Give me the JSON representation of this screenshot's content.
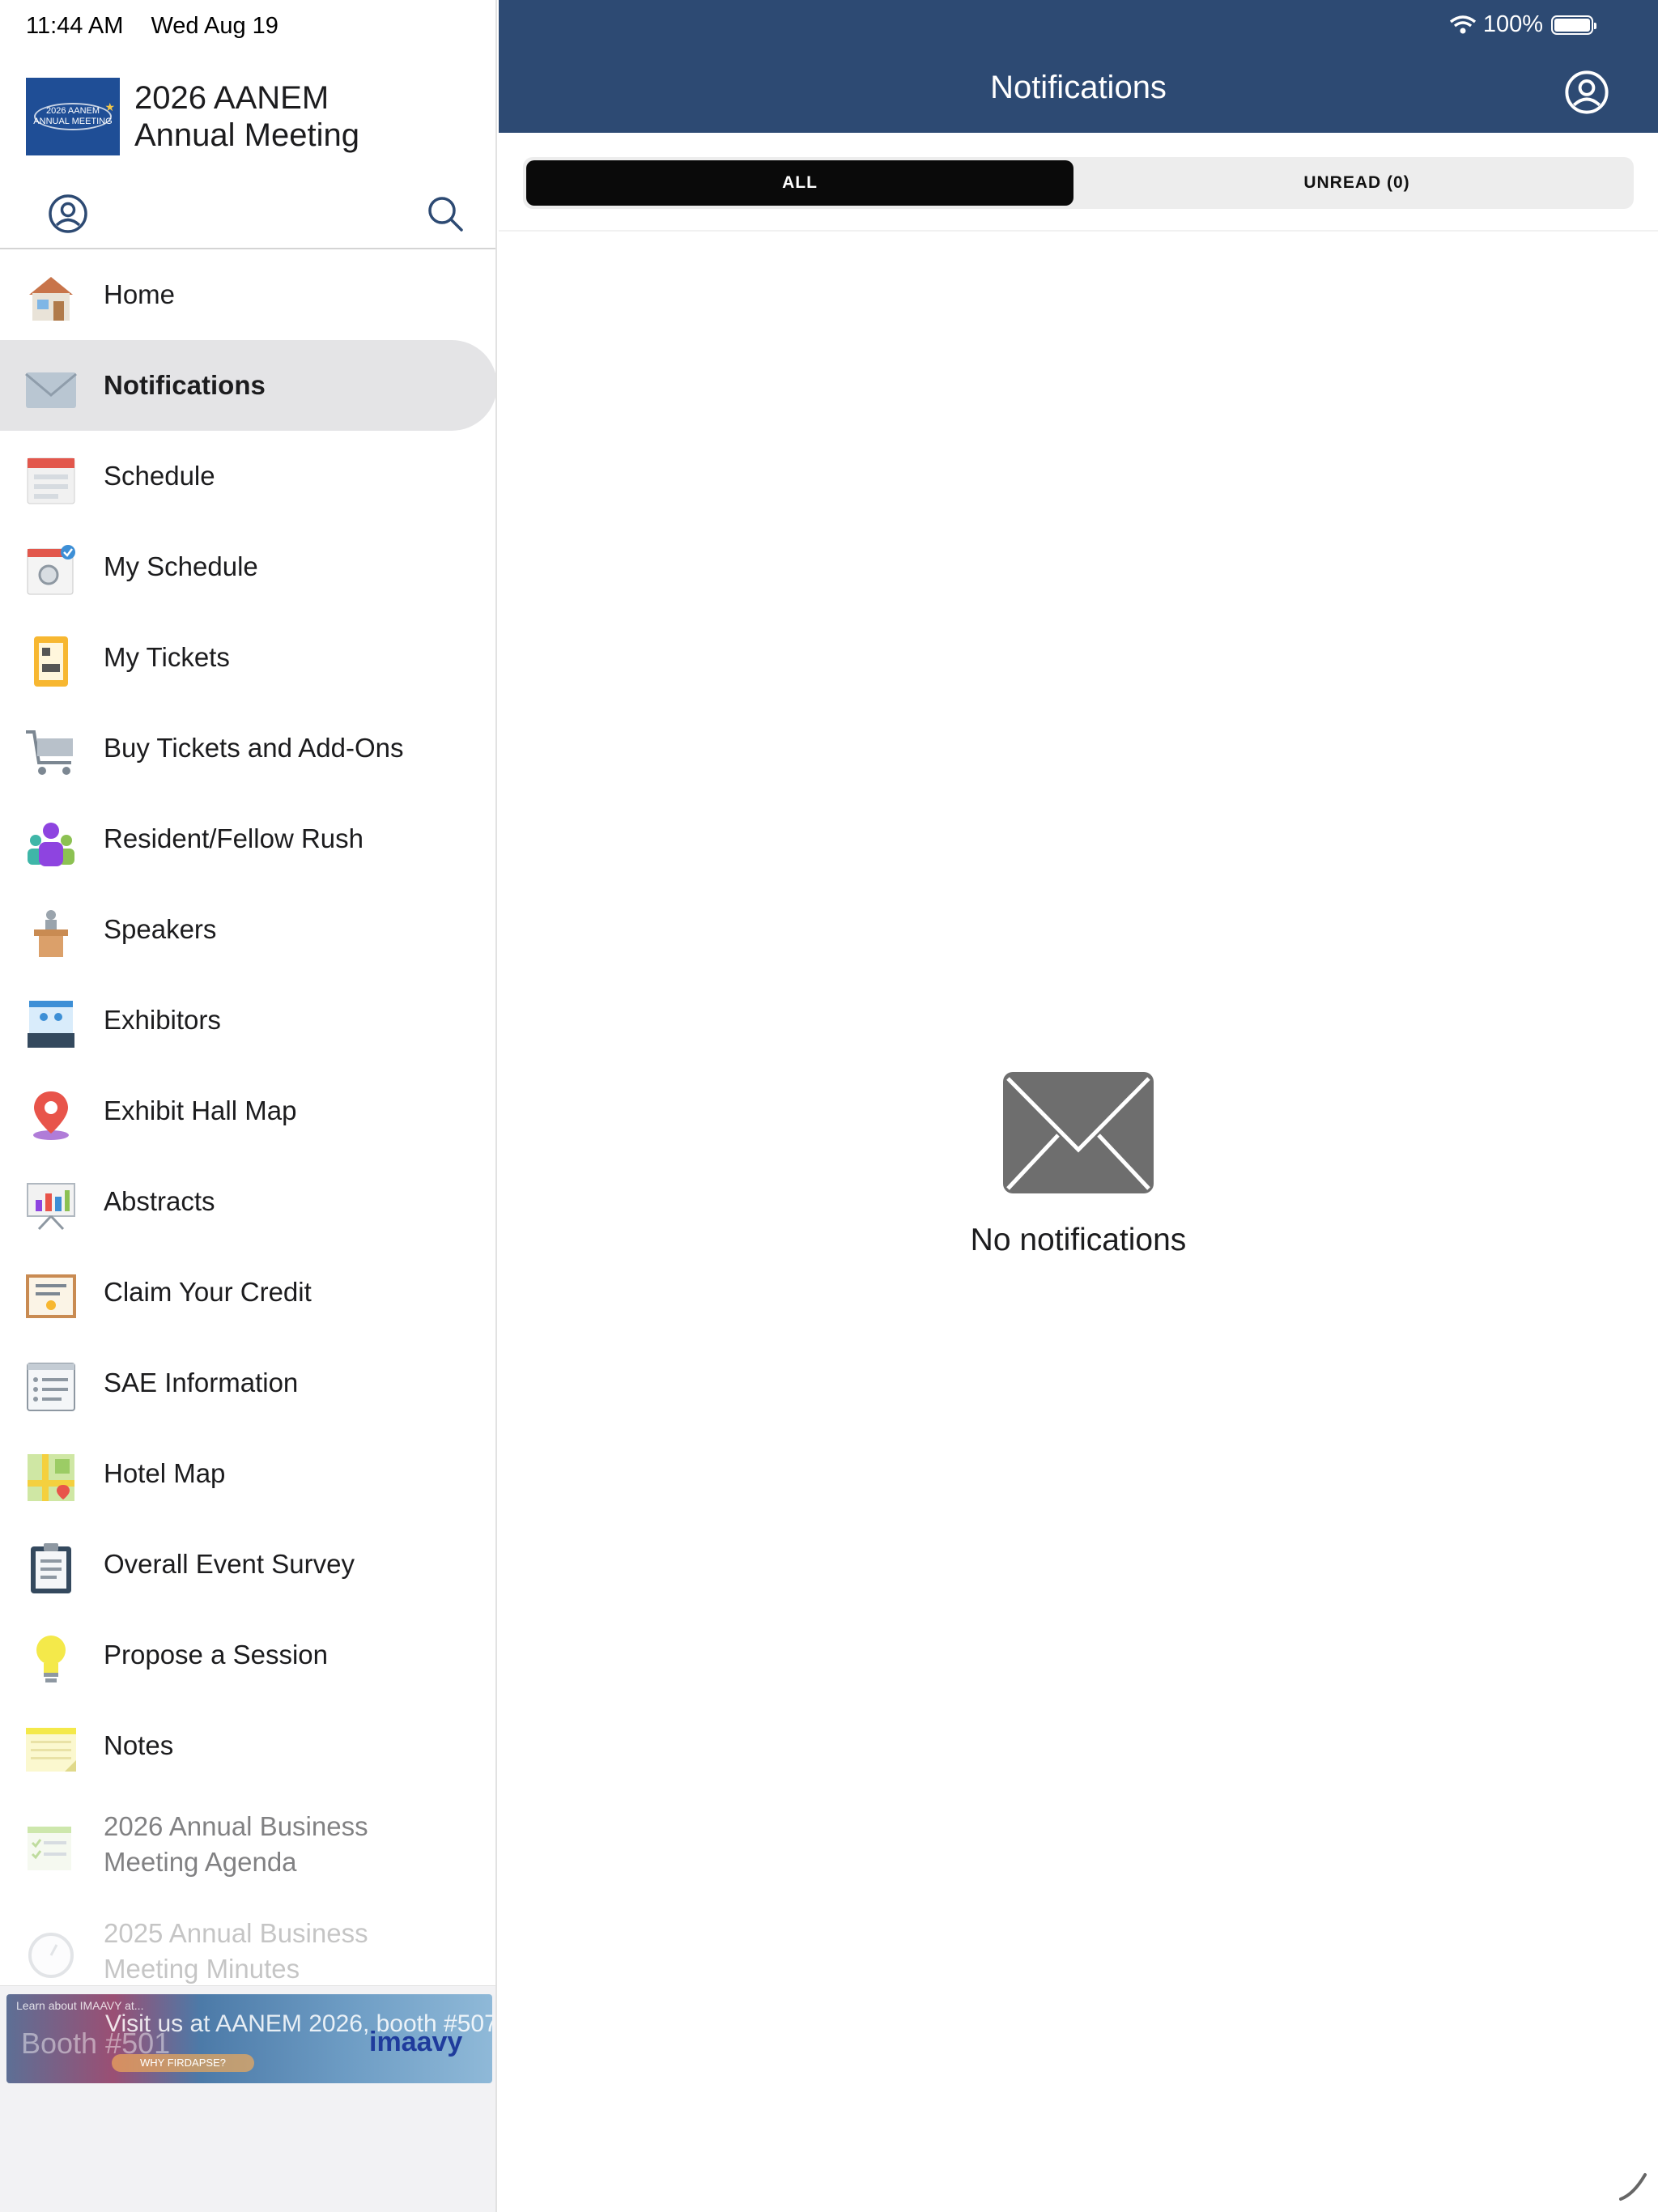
{
  "status_bar": {
    "time": "11:44 AM",
    "date": "Wed Aug 19",
    "battery": "100%"
  },
  "app": {
    "title": "2026 AANEM Annual Meeting",
    "logo_line1": "2026 AANEM",
    "logo_line2": "ANNUAL MEETING"
  },
  "sidebar": {
    "items": [
      {
        "label": "Home",
        "icon": "house-icon"
      },
      {
        "label": "Notifications",
        "icon": "envelope-icon",
        "active": true
      },
      {
        "label": "Schedule",
        "icon": "calendar-icon"
      },
      {
        "label": "My Schedule",
        "icon": "calendar-check-icon"
      },
      {
        "label": "My Tickets",
        "icon": "ticket-icon"
      },
      {
        "label": "Buy Tickets and Add-Ons",
        "icon": "cart-icon"
      },
      {
        "label": "Resident/Fellow Rush",
        "icon": "people-icon"
      },
      {
        "label": "Speakers",
        "icon": "podium-icon"
      },
      {
        "label": "Exhibitors",
        "icon": "booth-icon"
      },
      {
        "label": "Exhibit Hall Map",
        "icon": "map-pin-icon"
      },
      {
        "label": "Abstracts",
        "icon": "presentation-icon"
      },
      {
        "label": "Claim Your Credit",
        "icon": "certificate-icon"
      },
      {
        "label": "SAE Information",
        "icon": "document-list-icon"
      },
      {
        "label": "Hotel Map",
        "icon": "map-icon"
      },
      {
        "label": "Overall Event Survey",
        "icon": "clipboard-icon"
      },
      {
        "label": "Propose a Session",
        "icon": "lightbulb-icon"
      },
      {
        "label": "Notes",
        "icon": "notepad-icon"
      },
      {
        "label": "2026 Annual Business Meeting Agenda",
        "icon": "checklist-icon"
      },
      {
        "label": "2025 Annual Business Meeting Minutes",
        "icon": "clock-icon"
      }
    ]
  },
  "banner": {
    "headline": "Visit us at AANEM 2026, booth #507",
    "small": "Learn about IMAAVY at...",
    "booth": "Booth #501",
    "brand": "imaavy",
    "pill": "WHY FIRDAPSE?"
  },
  "main": {
    "title": "Notifications",
    "tabs": [
      {
        "label": "ALL"
      },
      {
        "label": "UNREAD (0)"
      }
    ],
    "empty_label": "No notifications"
  },
  "colors": {
    "nav_bar": "#2d4a73",
    "active_tab": "#0a0a0a",
    "active_menu": "#e4e4e6",
    "empty_icon": "#6e6e6e"
  }
}
